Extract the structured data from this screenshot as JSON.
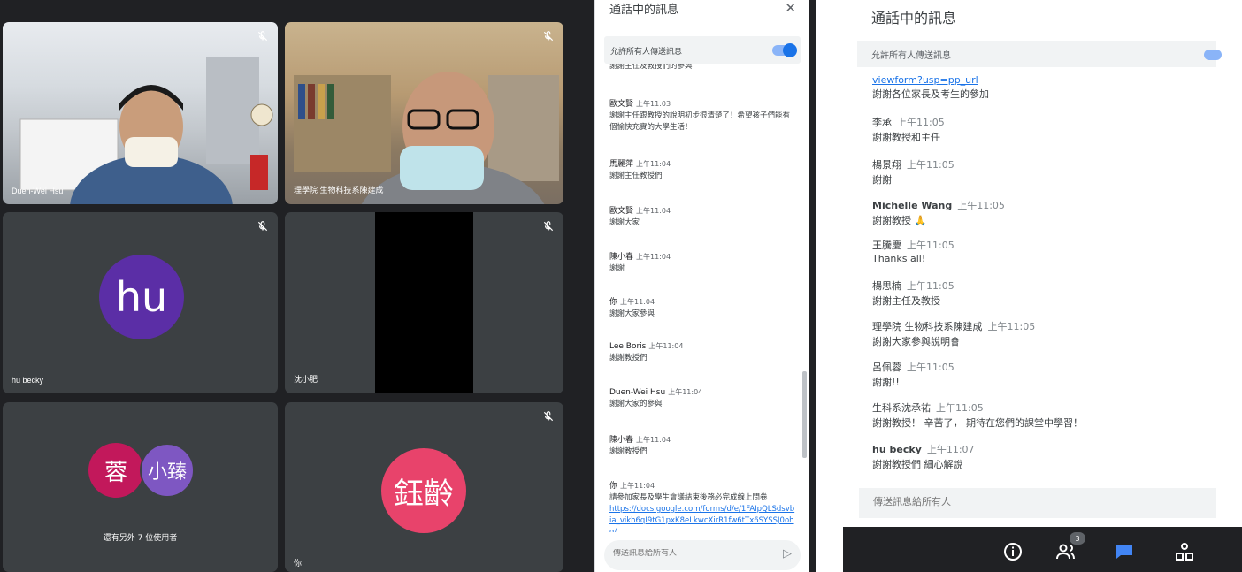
{
  "meet": {
    "tiles": [
      {
        "name": "Duen-Wei Hsu"
      },
      {
        "name": "理學院 生物科技系陳建成"
      },
      {
        "name": "hu becky",
        "avatar": "hu",
        "color": "#5b2ea6"
      },
      {
        "name": "沈小肥"
      },
      {
        "others_label": "還有另外 7 位使用者",
        "avatars": [
          {
            "text": "蓉",
            "color": "#c2185b"
          },
          {
            "text": "小臻",
            "color": "#7e57c2"
          }
        ]
      },
      {
        "name": "你",
        "avatar": "鈺齡",
        "color": "#e8436b"
      }
    ]
  },
  "chat_mid": {
    "title": "通話中的訊息",
    "close_icon": "close-icon",
    "toggle_label": "允許所有人傳送訊息",
    "messages": [
      {
        "sender": "歐文賢",
        "time": "上午11:03",
        "text": "謝謝主任跟教授的說明初步很清楚了！希望孩子們能有個愉快充實的大學生活！"
      },
      {
        "sender": "馬麗萍",
        "time": "上午11:04",
        "text": "謝謝主任教授們"
      },
      {
        "sender": "歐文賢",
        "time": "上午11:04",
        "text": "謝謝大家"
      },
      {
        "sender": "陳小春",
        "time": "上午11:04",
        "text": "謝謝"
      },
      {
        "sender": "你",
        "time": "上午11:04",
        "text": "謝謝大家參與"
      },
      {
        "sender": "Lee Boris",
        "time": "上午11:04",
        "text": "謝謝教授們"
      },
      {
        "sender": "Duen-Wei Hsu",
        "time": "上午11:04",
        "text": "謝謝大家的參與"
      },
      {
        "sender": "陳小春",
        "time": "上午11:04",
        "text": "謝謝教授們"
      },
      {
        "sender": "你",
        "time": "上午11:04",
        "text": "請參加家長及學生會議結束後務必完成線上問卷",
        "link": "https://docs.google.com/forms/d/e/1FAIpQLSdsvbia_vikh6qI9tG1pxK8eLkwcXirR1fw6tTx6SYSSJ0ohq/"
      }
    ],
    "input_placeholder": "傳送訊息給所有人"
  },
  "chat_right": {
    "title": "通話中的訊息",
    "toggle_label": "允許所有人傳送訊息",
    "first_link": "viewform?usp=pp_url",
    "first_text": "謝謝各位家長及考生的參加",
    "messages": [
      {
        "sender": "李承",
        "time": "上午11:05",
        "text": "謝謝教授和主任"
      },
      {
        "sender": "楊景翔",
        "time": "上午11:05",
        "text": "謝謝"
      },
      {
        "sender": "Michelle Wang",
        "time": "上午11:05",
        "text": "謝謝教授 🙏"
      },
      {
        "sender": "王騰慶",
        "time": "上午11:05",
        "text": "Thanks all!"
      },
      {
        "sender": "楊思楠",
        "time": "上午11:05",
        "text": "謝謝主任及教授"
      },
      {
        "sender": "理學院 生物科技系陳建成",
        "time": "上午11:05",
        "text": "謝謝大家參與說明會"
      },
      {
        "sender": "呂佩蓉",
        "time": "上午11:05",
        "text": "謝謝!!"
      },
      {
        "sender": "生科系沈承祐",
        "time": "上午11:05",
        "text": "謝謝教授！ 辛苦了， 期待在您們的課堂中學習！"
      },
      {
        "sender": "hu becky",
        "time": "上午11:07",
        "text": "謝謝教授們 細心解說"
      }
    ],
    "input_placeholder": "傳送訊息給所有人",
    "bottom_bar": {
      "people_count": "3"
    }
  },
  "colors": {
    "accent": "#1a73e8",
    "dark_bg": "#202124",
    "tile_bg": "#3c4043"
  }
}
